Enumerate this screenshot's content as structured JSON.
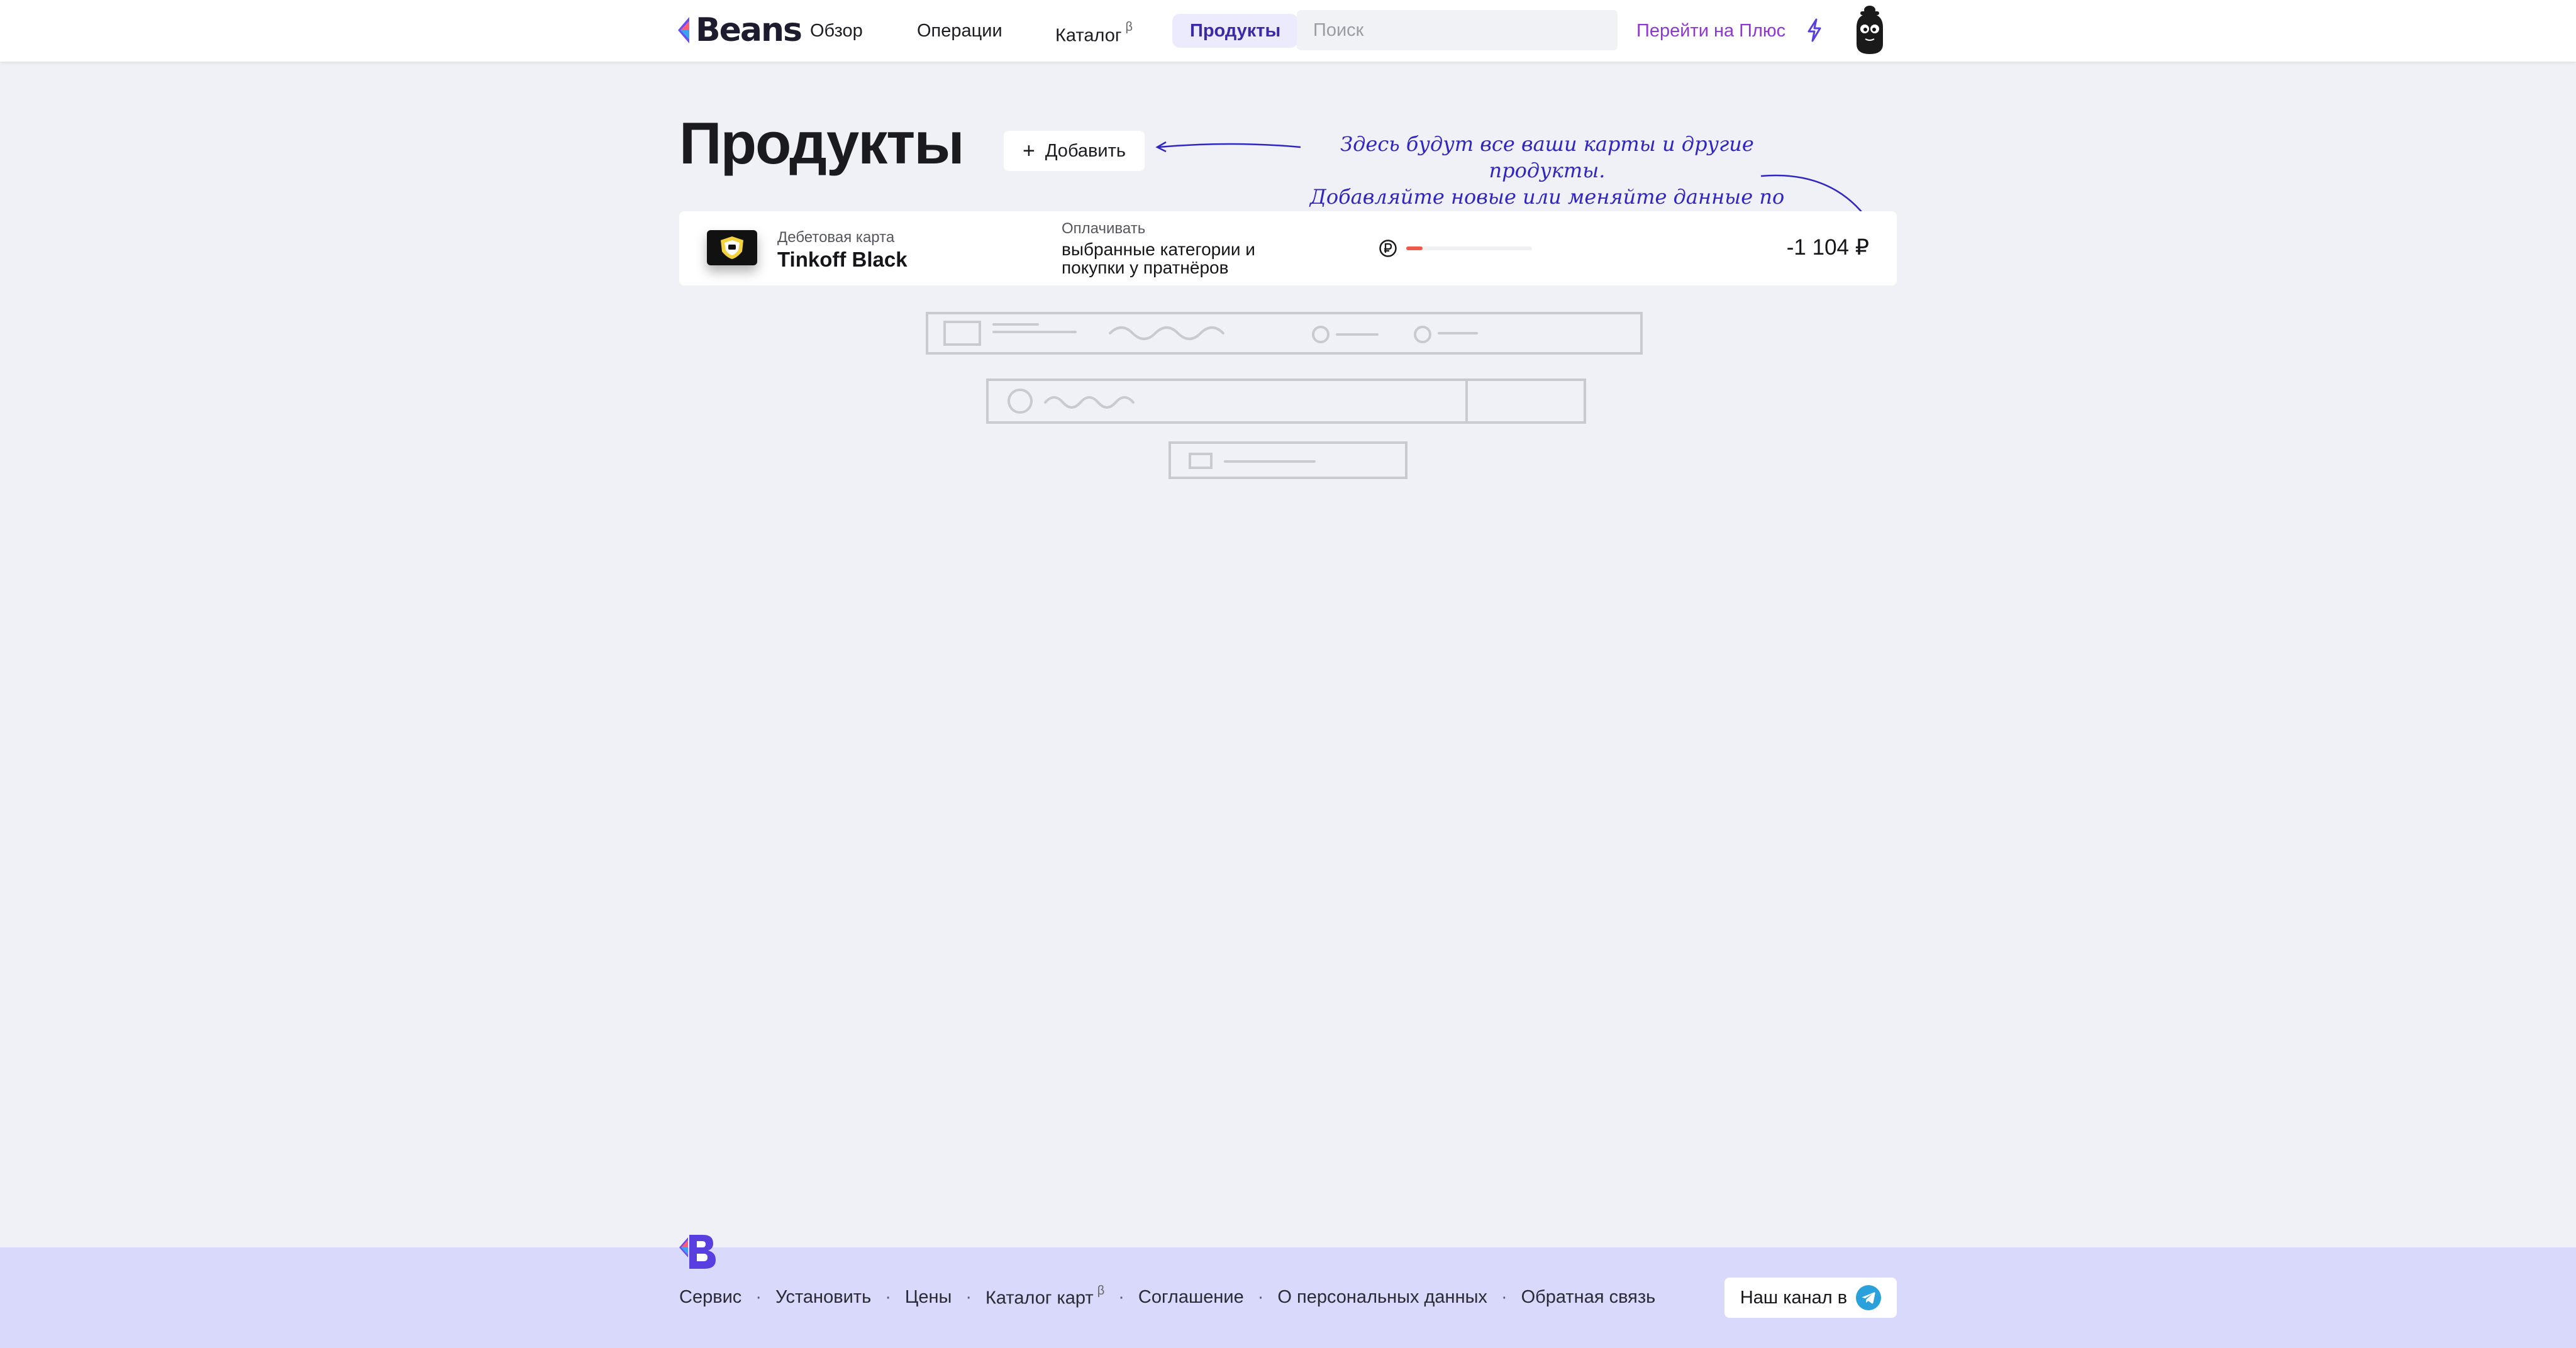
{
  "header": {
    "logo_text": "Beans",
    "nav": [
      {
        "label": "Обзор"
      },
      {
        "label": "Операции"
      },
      {
        "label": "Каталог",
        "badge": "β"
      },
      {
        "label": "Продукты",
        "active": true
      }
    ],
    "search_placeholder": "Поиск",
    "plus_link": "Перейти на Плюс",
    "icons": {
      "bolt": "bolt-icon",
      "avatar": "mascot-avatar"
    }
  },
  "main": {
    "title": "Продукты",
    "add_label": "Добавить",
    "hint_line1": "Здесь будут все ваши карты и другие продукты.",
    "hint_line2": "Добавляйте новые или меняйте данные по текущим",
    "products": [
      {
        "type": "Дебетовая карта",
        "name": "Tinkoff Black",
        "pay_label": "Оплачивать",
        "pay_desc": "выбранные категории и покупки у пратнёров",
        "progress_fraction": 0.13,
        "amount": "-1 104 ₽"
      }
    ]
  },
  "footer": {
    "links": [
      {
        "label": "Сервис"
      },
      {
        "label": "Установить"
      },
      {
        "label": "Цены"
      },
      {
        "label": "Каталог карт",
        "badge": "β"
      },
      {
        "label": "Соглашение"
      },
      {
        "label": "О персональных данных"
      },
      {
        "label": "Обратная связь"
      }
    ],
    "channel_label": "Наш канал в"
  },
  "colors": {
    "accent": "#3a2aa8",
    "plus_link": "#8e37d7",
    "hint_ink": "#3025c2",
    "progress": "#ee5a4a",
    "footer_bg": "#d9d9fb",
    "page_bg": "#f0f1f6"
  }
}
